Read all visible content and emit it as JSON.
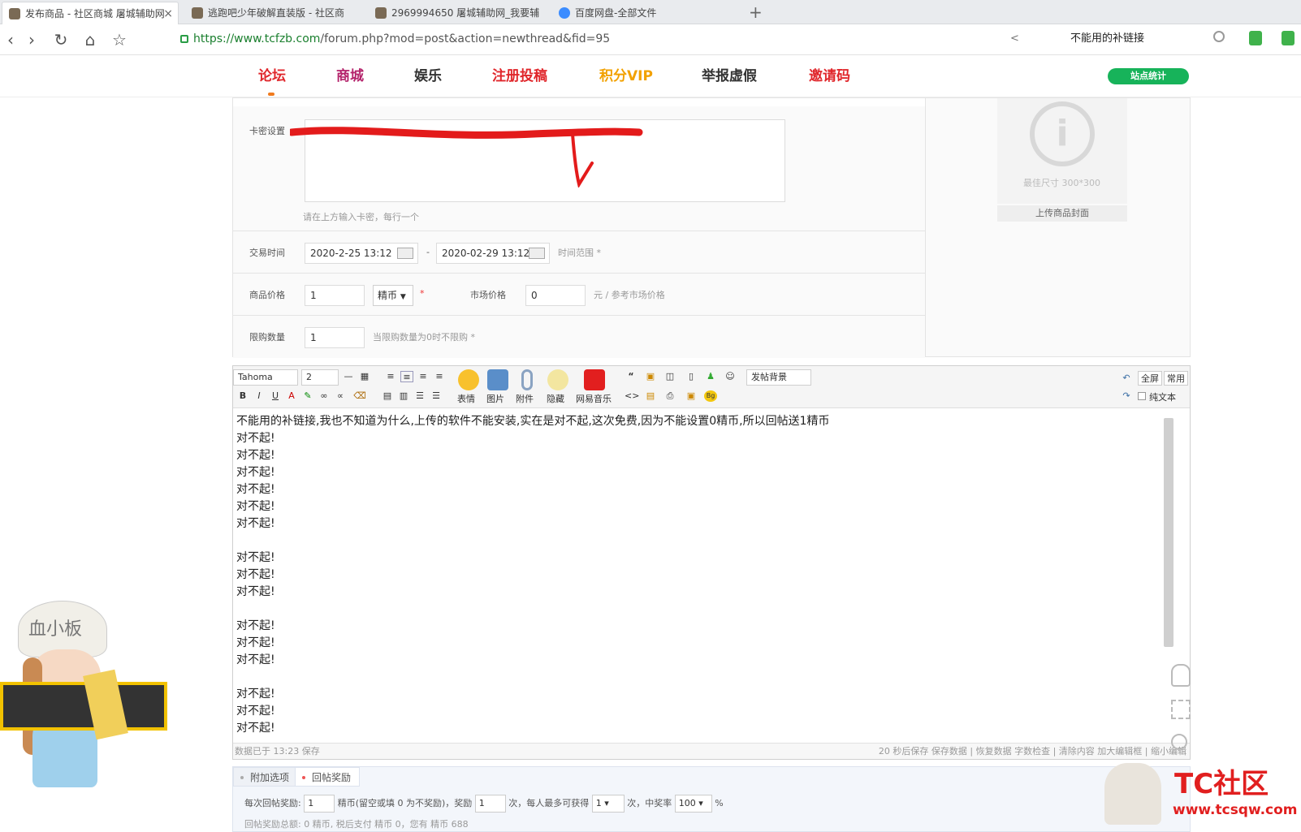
{
  "browser": {
    "tabs": [
      {
        "label": "发布商品 - 社区商城 屠城辅助网",
        "active": true
      },
      {
        "label": "逃跑吧少年破解直装版 - 社区商",
        "active": false
      },
      {
        "label": "2969994650 屠城辅助网_我要辅",
        "active": false
      },
      {
        "label": "百度网盘-全部文件",
        "active": false
      }
    ],
    "new_tab": "+",
    "close": "×",
    "url_host": "https://www.tcfzb.com",
    "url_path": "/forum.php?mod=post&action=newthread&fid=95",
    "search_text": "不能用的补链接",
    "back": "‹",
    "forward": "›",
    "reload": "↻",
    "home": "⌂",
    "star": "☆"
  },
  "site_nav": {
    "items": [
      {
        "label": "论坛",
        "color": "#e0262b"
      },
      {
        "label": "商城",
        "color": "#b4236b"
      },
      {
        "label": "娱乐",
        "color": "#333333"
      },
      {
        "label": "注册投稿",
        "color": "#e0262b"
      },
      {
        "label": "积分VIP",
        "color": "#f2a100"
      },
      {
        "label": "举报虚假",
        "color": "#333333"
      },
      {
        "label": "邀请码",
        "color": "#e0262b"
      }
    ],
    "stats_button": "站点统计"
  },
  "form": {
    "card_label": "卡密设置",
    "card_hint": "请在上方输入卡密，每行一个",
    "cover_size": "最佳尺寸 300*300",
    "cover_button": "上传商品封面",
    "trade_time_label": "交易时间",
    "trade_start": "2020-2-25 13:12",
    "trade_end": "2020-02-29 13:12",
    "trade_sep": "-",
    "trade_hint": "时间范围 *",
    "price_label": "商品价格",
    "price_value": "1",
    "currency": "精币",
    "required": "*",
    "market_label": "市场价格",
    "market_value": "0",
    "market_hint": "元 / 参考市场价格",
    "limit_label": "限购数量",
    "limit_value": "1",
    "limit_hint": "当限购数量为0时不限购 *"
  },
  "editor": {
    "font": "Tahoma",
    "size": "2",
    "bg_select": "发帖背景",
    "btn_full": "全屏",
    "btn_common": "常用",
    "plain_text": "纯文本",
    "big_buttons": [
      "表情",
      "图片",
      "附件",
      "隐藏",
      "网易音乐"
    ],
    "lines": [
      "不能用的补链接,我也不知道为什么,上传的软件不能安装,实在是对不起,这次免费,因为不能设置0精币,所以回帖送1精币",
      "对不起!",
      "对不起!",
      "对不起!",
      "对不起!",
      "对不起!",
      "对不起!",
      "",
      "对不起!",
      "对不起!",
      "对不起!",
      "",
      "对不起!",
      "对不起!",
      "对不起!",
      "",
      "对不起!",
      "对不起!",
      "对不起!"
    ],
    "status_left": "数据已于 13:23 保存",
    "status_right": "20 秒后保存 保存数据 | 恢复数据    字数检查 | 清除内容    加大编辑框 | 缩小编辑"
  },
  "reward": {
    "tab_extra": "附加选项",
    "tab_reply": "回帖奖励",
    "line1_a": "每次回帖奖励:",
    "line1_v1": "1",
    "line1_b": "精币(留空或填 0 为不奖励)，奖励",
    "line1_v2": "1",
    "line1_c": "次，每人最多可获得",
    "line1_v3": "1",
    "line1_d": "次，中奖率",
    "line1_v4": "100",
    "line1_e": "%",
    "line2": "回帖奖励总额: 0 精币, 税后支付 精币 0，您有 精币 688"
  },
  "watermark": {
    "brand": "TC社区",
    "url": "www.tcsqw.com",
    "mascot_text": "血小板"
  }
}
